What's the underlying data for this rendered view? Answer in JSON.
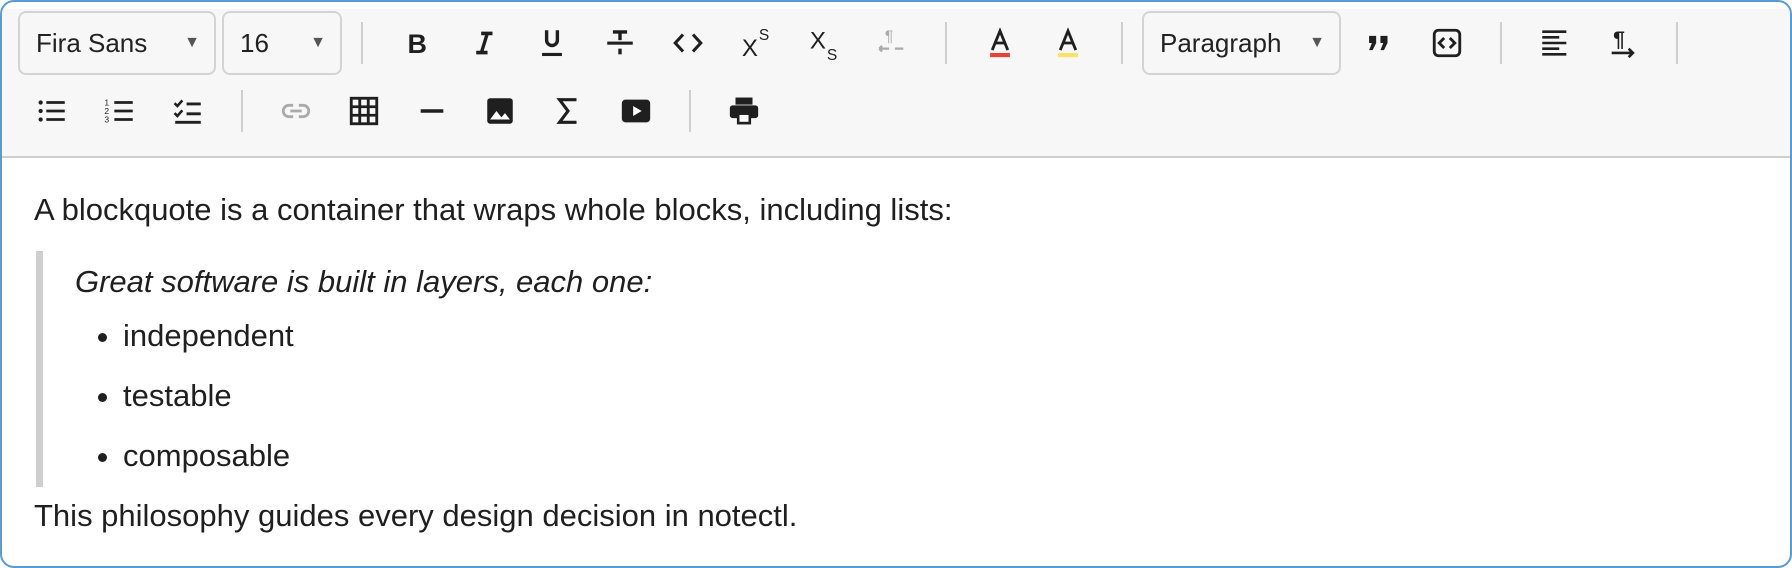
{
  "toolbar": {
    "font_family": "Fira Sans",
    "font_size": "16",
    "block_type": "Paragraph",
    "icons": [
      "bold-icon",
      "italic-icon",
      "underline-icon",
      "strikethrough-icon",
      "code-icon",
      "superscript-icon",
      "subscript-icon",
      "clear-formatting-icon",
      "text-color-icon",
      "highlight-color-icon",
      "blockquote-icon",
      "code-block-icon",
      "align-left-icon",
      "text-direction-icon",
      "bullet-list-icon",
      "numbered-list-icon",
      "checklist-icon",
      "link-icon",
      "table-icon",
      "horizontal-rule-icon",
      "image-icon",
      "math-icon",
      "video-icon",
      "print-icon"
    ],
    "colors": {
      "text_color": "#e0453a",
      "highlight_color": "#f7e36a"
    }
  },
  "content": {
    "intro": "A blockquote is a container that wraps whole blocks, including lists:",
    "quote_lead": "Great software is built in layers, each one:",
    "quote_items": [
      "independent",
      "testable",
      "composable"
    ],
    "outro": "This philosophy guides every design decision in notectl."
  }
}
